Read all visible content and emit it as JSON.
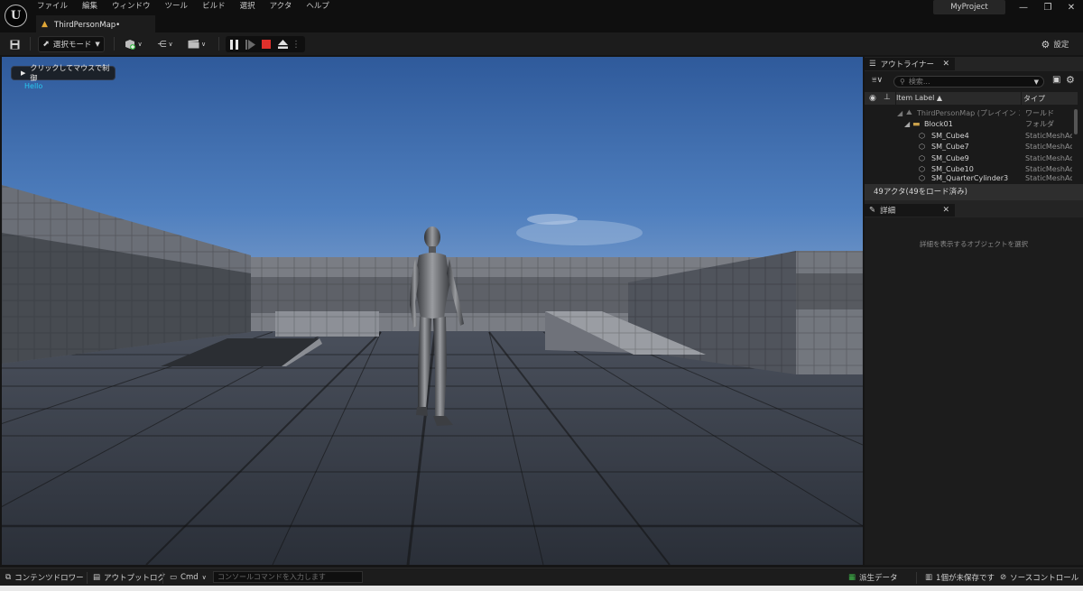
{
  "menu": [
    "ファイル",
    "編集",
    "ウィンドウ",
    "ツール",
    "ビルド",
    "選択",
    "アクタ",
    "ヘルプ"
  ],
  "document_tab": {
    "label": "ThirdPersonMap•",
    "icon": "level-icon"
  },
  "project_name": "MyProject",
  "toolbar": {
    "mode_label": "選択モード",
    "settings_label": "設定"
  },
  "viewport": {
    "click_hint": "クリックしてマウスで制御",
    "hello_text": "Hello"
  },
  "outliner": {
    "tab_label": "アウトライナー",
    "search_placeholder": "検索...",
    "col_label": "Item Label ▲",
    "col_type": "タイプ",
    "items": [
      {
        "label": "ThirdPersonMap (プレイイン エディタ)",
        "type": "ワールド",
        "icon": "world-icon"
      },
      {
        "label": "Block01",
        "type": "フォルダ",
        "icon": "folder-icon"
      },
      {
        "label": "SM_Cube4",
        "type": "StaticMeshActor",
        "icon": "mesh-icon"
      },
      {
        "label": "SM_Cube7",
        "type": "StaticMeshActor",
        "icon": "mesh-icon"
      },
      {
        "label": "SM_Cube9",
        "type": "StaticMeshActor",
        "icon": "mesh-icon"
      },
      {
        "label": "SM_Cube10",
        "type": "StaticMeshActor",
        "icon": "mesh-icon"
      },
      {
        "label": "SM_QuarterCylinder3",
        "type": "StaticMeshActor",
        "icon": "mesh-icon"
      }
    ],
    "actor_count": "49アクタ(49をロード済み)"
  },
  "details": {
    "tab_label": "詳細",
    "hint": "詳細を表示するオブジェクトを選択"
  },
  "statusbar": {
    "content_drawer": "コンテンツドロワー",
    "output_log": "アウトプットログ",
    "cmd": "Cmd",
    "console_placeholder": "コンソールコマンドを入力します",
    "derived_data": "派生データ",
    "unsaved": "1個が未保存です",
    "source_control": "ソースコントロール"
  },
  "colors": {
    "accent_play_stop": "#e0302b",
    "hello_text": "#28c8f0",
    "level_icon": "#e1a636",
    "folder_icon": "#c9a04a"
  }
}
